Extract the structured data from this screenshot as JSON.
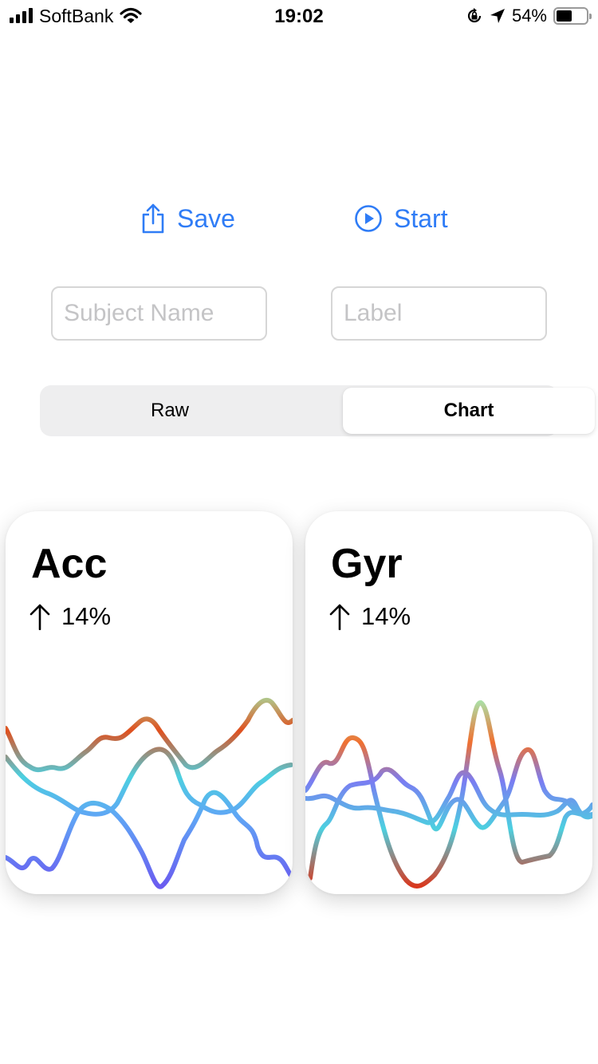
{
  "status_bar": {
    "carrier": "SoftBank",
    "time": "19:02",
    "battery_percent": "54%",
    "battery_level": 0.54,
    "icons": [
      "signal-icon",
      "wifi-icon",
      "orientation-lock-icon",
      "location-arrow-icon",
      "battery-icon"
    ]
  },
  "actions": {
    "save_label": "Save",
    "start_label": "Start",
    "accent_color": "#2f7cf6",
    "save_icon": "share-icon",
    "start_icon": "play-circle-icon"
  },
  "inputs": {
    "subject_placeholder": "Subject Name",
    "subject_value": "",
    "label_placeholder": "Label",
    "label_value": ""
  },
  "segmented": {
    "options": [
      "Raw",
      "Chart"
    ],
    "selected": "Chart"
  },
  "cards": [
    {
      "title": "Acc",
      "trend_icon": "arrow-up-icon",
      "trend_value": "14%",
      "series_colors": [
        "#ff8a4c",
        "#a9f2b3",
        "#4cd0e0",
        "#7a7cf2"
      ]
    },
    {
      "title": "Gyr",
      "trend_icon": "arrow-up-icon",
      "trend_value": "14%",
      "series_colors": [
        "#ff8a4c",
        "#a9f2b3",
        "#4cd0e0",
        "#7a7cf2"
      ]
    }
  ]
}
